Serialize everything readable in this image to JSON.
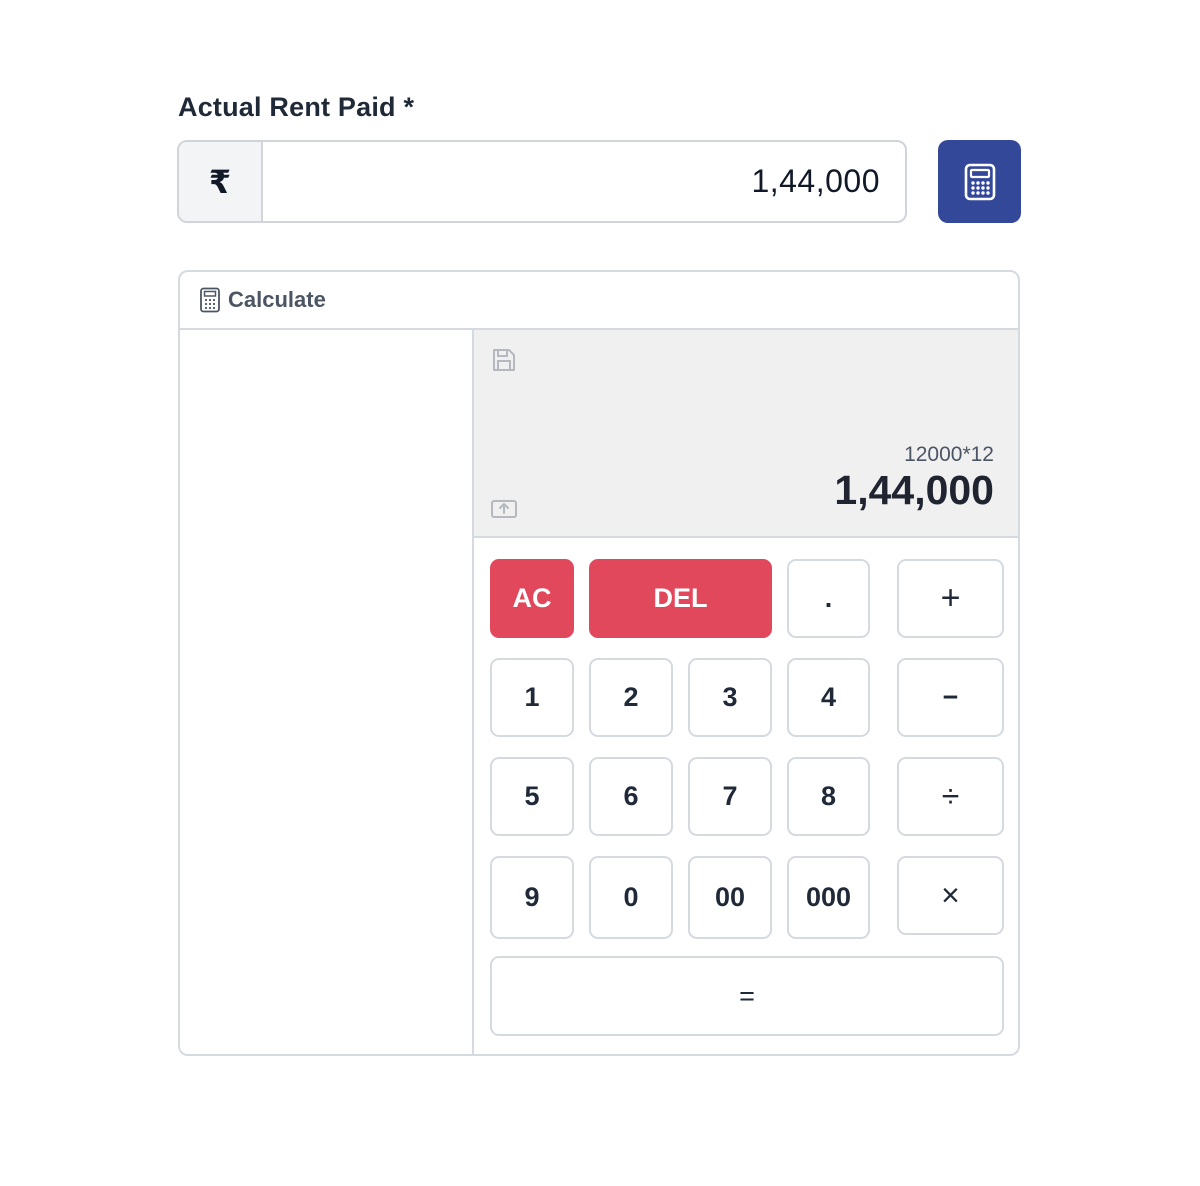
{
  "field": {
    "label": "Actual Rent Paid *",
    "currency_symbol": "₹",
    "value": "1,44,000"
  },
  "calculator_button_icon": "calculator-icon",
  "panel": {
    "title": "Calculate",
    "title_icon": "calculator-icon",
    "display": {
      "expression": "12000*12",
      "result": "1,44,000",
      "save_icon": "save-icon",
      "upload_icon": "upload-icon"
    },
    "keys": {
      "ac": "AC",
      "del": "DEL",
      "dot": ".",
      "plus": "+",
      "one": "1",
      "two": "2",
      "three": "3",
      "four": "4",
      "minus": "−",
      "five": "5",
      "six": "6",
      "seven": "7",
      "eight": "8",
      "divide": "÷",
      "nine": "9",
      "zero": "0",
      "double_zero": "00",
      "triple_zero": "000",
      "multiply": "×",
      "equals": "="
    }
  },
  "colors": {
    "accent": "#34489a",
    "danger": "#e2485c",
    "display_bg": "#f0f0f0",
    "border": "#d5d9e0"
  }
}
